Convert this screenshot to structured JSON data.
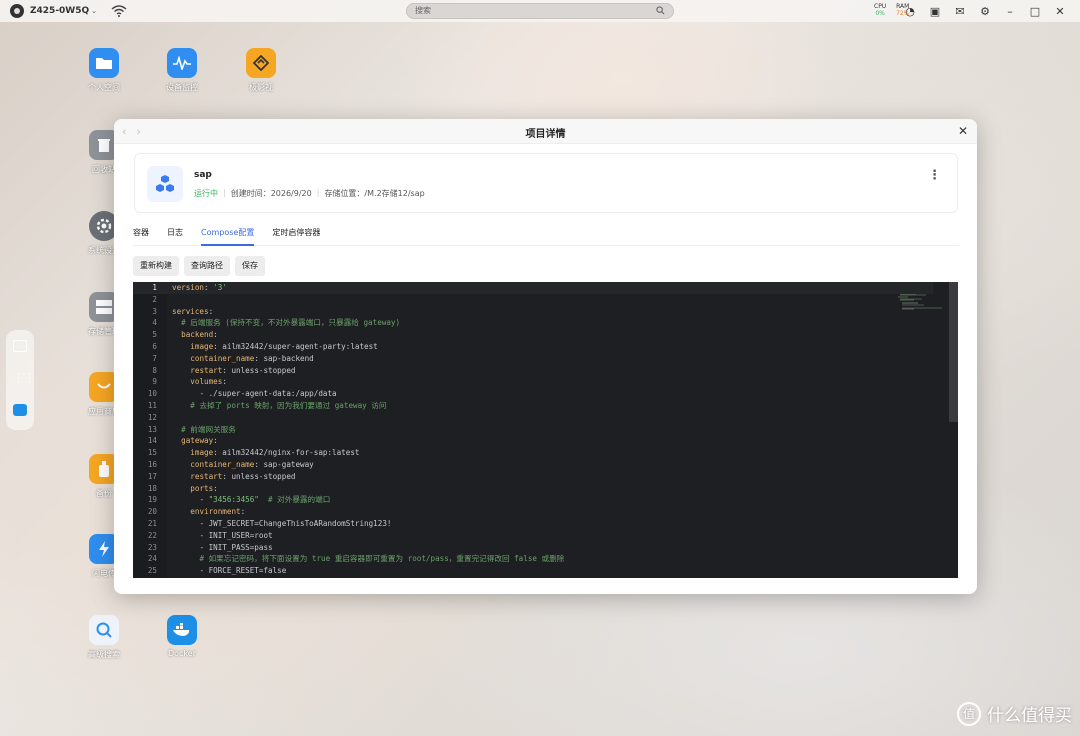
{
  "topbar": {
    "device": "Z425-0W5Q",
    "search_placeholder": "搜索",
    "cpu_label": "CPU",
    "cpu_value": "0%",
    "ram_label": "RAM",
    "ram_value": "72%"
  },
  "desktop_icons": [
    {
      "label": "个人空间",
      "color": "#2f8ef0"
    },
    {
      "label": "设备监控",
      "color": "#2f8ef0"
    },
    {
      "label": "极影视",
      "color": "#f5a623"
    },
    {
      "label": "回收站",
      "color": "#8e9399"
    },
    {
      "label": "系统设置",
      "color": "#6b7077"
    },
    {
      "label": "存储管理",
      "color": "#8e9399"
    },
    {
      "label": "应用商店",
      "color": "#f5a623"
    },
    {
      "label": "备份",
      "color": "#f5a623"
    },
    {
      "label": "闪电传",
      "color": "#2f8ef0"
    },
    {
      "label": "高级搜索",
      "color": "#dce7f5"
    },
    {
      "label": "Docker",
      "color": "#1d8fe6"
    }
  ],
  "modal": {
    "title": "项目详情",
    "project": {
      "name": "sap",
      "status": "运行中",
      "created": "创建时间：2026/9/20",
      "storage": "存储位置：/M.2存储12/sap"
    },
    "tabs": [
      "容器",
      "日志",
      "Compose配置",
      "定时启停容器"
    ],
    "active_tab": "Compose配置",
    "buttons": [
      "重新构建",
      "查询路径",
      "保存"
    ]
  },
  "code_lines": [
    {
      "n": "1",
      "t": "version: '3'"
    },
    {
      "n": "2",
      "t": ""
    },
    {
      "n": "3",
      "t": "services:"
    },
    {
      "n": "4",
      "t": "  # 后端服务 (保持不变，不对外暴露端口，只暴露给 gateway)"
    },
    {
      "n": "5",
      "t": "  backend:"
    },
    {
      "n": "6",
      "t": "    image: ailm32442/super-agent-party:latest"
    },
    {
      "n": "7",
      "t": "    container_name: sap-backend"
    },
    {
      "n": "8",
      "t": "    restart: unless-stopped"
    },
    {
      "n": "9",
      "t": "    volumes:"
    },
    {
      "n": "10",
      "t": "      - ./super-agent-data:/app/data"
    },
    {
      "n": "11",
      "t": "    # 去掉了 ports 映射，因为我们要通过 gateway 访问"
    },
    {
      "n": "12",
      "t": ""
    },
    {
      "n": "13",
      "t": "  # 前端网关服务"
    },
    {
      "n": "14",
      "t": "  gateway:"
    },
    {
      "n": "15",
      "t": "    image: ailm32442/nginx-for-sap:latest"
    },
    {
      "n": "16",
      "t": "    container_name: sap-gateway"
    },
    {
      "n": "17",
      "t": "    restart: unless-stopped"
    },
    {
      "n": "18",
      "t": "    ports:"
    },
    {
      "n": "19",
      "t": "      - \"3456:3456\"  # 对外暴露的端口"
    },
    {
      "n": "20",
      "t": "    environment:"
    },
    {
      "n": "21",
      "t": "      - JWT_SECRET=ChangeThisToARandomString123!"
    },
    {
      "n": "22",
      "t": "      - INIT_USER=root"
    },
    {
      "n": "23",
      "t": "      - INIT_PASS=pass"
    },
    {
      "n": "24",
      "t": "      # 如果忘记密码，将下面设置为 true 重启容器即可重置为 root/pass，重置完记得改回 false 或删除"
    },
    {
      "n": "25",
      "t": "      - FORCE_RESET=false"
    }
  ],
  "watermark": "什么值得买"
}
